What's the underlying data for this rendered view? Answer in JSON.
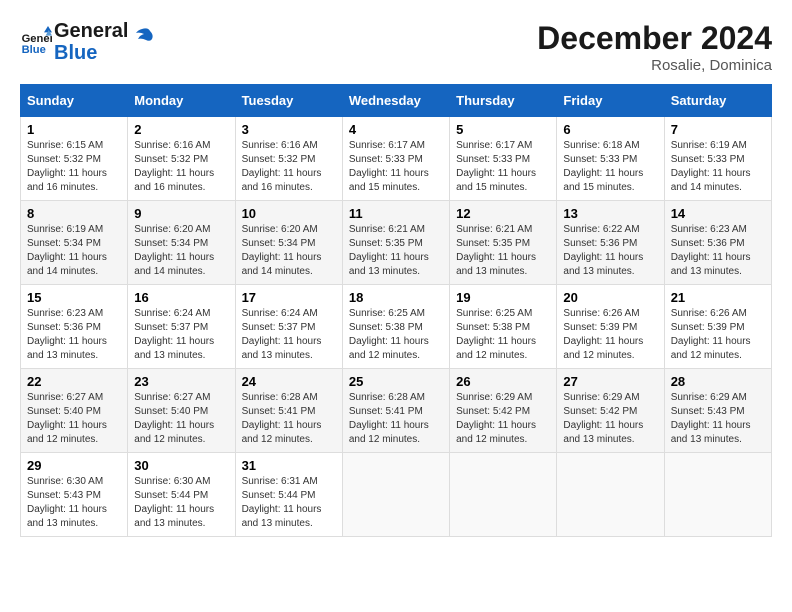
{
  "logo": {
    "text_general": "General",
    "text_blue": "Blue"
  },
  "title": "December 2024",
  "subtitle": "Rosalie, Dominica",
  "days_header": [
    "Sunday",
    "Monday",
    "Tuesday",
    "Wednesday",
    "Thursday",
    "Friday",
    "Saturday"
  ],
  "weeks": [
    [
      {
        "day": "1",
        "sunrise": "6:15 AM",
        "sunset": "5:32 PM",
        "daylight": "11 hours and 16 minutes."
      },
      {
        "day": "2",
        "sunrise": "6:16 AM",
        "sunset": "5:32 PM",
        "daylight": "11 hours and 16 minutes."
      },
      {
        "day": "3",
        "sunrise": "6:16 AM",
        "sunset": "5:32 PM",
        "daylight": "11 hours and 16 minutes."
      },
      {
        "day": "4",
        "sunrise": "6:17 AM",
        "sunset": "5:33 PM",
        "daylight": "11 hours and 15 minutes."
      },
      {
        "day": "5",
        "sunrise": "6:17 AM",
        "sunset": "5:33 PM",
        "daylight": "11 hours and 15 minutes."
      },
      {
        "day": "6",
        "sunrise": "6:18 AM",
        "sunset": "5:33 PM",
        "daylight": "11 hours and 15 minutes."
      },
      {
        "day": "7",
        "sunrise": "6:19 AM",
        "sunset": "5:33 PM",
        "daylight": "11 hours and 14 minutes."
      }
    ],
    [
      {
        "day": "8",
        "sunrise": "6:19 AM",
        "sunset": "5:34 PM",
        "daylight": "11 hours and 14 minutes."
      },
      {
        "day": "9",
        "sunrise": "6:20 AM",
        "sunset": "5:34 PM",
        "daylight": "11 hours and 14 minutes."
      },
      {
        "day": "10",
        "sunrise": "6:20 AM",
        "sunset": "5:34 PM",
        "daylight": "11 hours and 14 minutes."
      },
      {
        "day": "11",
        "sunrise": "6:21 AM",
        "sunset": "5:35 PM",
        "daylight": "11 hours and 13 minutes."
      },
      {
        "day": "12",
        "sunrise": "6:21 AM",
        "sunset": "5:35 PM",
        "daylight": "11 hours and 13 minutes."
      },
      {
        "day": "13",
        "sunrise": "6:22 AM",
        "sunset": "5:36 PM",
        "daylight": "11 hours and 13 minutes."
      },
      {
        "day": "14",
        "sunrise": "6:23 AM",
        "sunset": "5:36 PM",
        "daylight": "11 hours and 13 minutes."
      }
    ],
    [
      {
        "day": "15",
        "sunrise": "6:23 AM",
        "sunset": "5:36 PM",
        "daylight": "11 hours and 13 minutes."
      },
      {
        "day": "16",
        "sunrise": "6:24 AM",
        "sunset": "5:37 PM",
        "daylight": "11 hours and 13 minutes."
      },
      {
        "day": "17",
        "sunrise": "6:24 AM",
        "sunset": "5:37 PM",
        "daylight": "11 hours and 13 minutes."
      },
      {
        "day": "18",
        "sunrise": "6:25 AM",
        "sunset": "5:38 PM",
        "daylight": "11 hours and 12 minutes."
      },
      {
        "day": "19",
        "sunrise": "6:25 AM",
        "sunset": "5:38 PM",
        "daylight": "11 hours and 12 minutes."
      },
      {
        "day": "20",
        "sunrise": "6:26 AM",
        "sunset": "5:39 PM",
        "daylight": "11 hours and 12 minutes."
      },
      {
        "day": "21",
        "sunrise": "6:26 AM",
        "sunset": "5:39 PM",
        "daylight": "11 hours and 12 minutes."
      }
    ],
    [
      {
        "day": "22",
        "sunrise": "6:27 AM",
        "sunset": "5:40 PM",
        "daylight": "11 hours and 12 minutes."
      },
      {
        "day": "23",
        "sunrise": "6:27 AM",
        "sunset": "5:40 PM",
        "daylight": "11 hours and 12 minutes."
      },
      {
        "day": "24",
        "sunrise": "6:28 AM",
        "sunset": "5:41 PM",
        "daylight": "11 hours and 12 minutes."
      },
      {
        "day": "25",
        "sunrise": "6:28 AM",
        "sunset": "5:41 PM",
        "daylight": "11 hours and 12 minutes."
      },
      {
        "day": "26",
        "sunrise": "6:29 AM",
        "sunset": "5:42 PM",
        "daylight": "11 hours and 12 minutes."
      },
      {
        "day": "27",
        "sunrise": "6:29 AM",
        "sunset": "5:42 PM",
        "daylight": "11 hours and 13 minutes."
      },
      {
        "day": "28",
        "sunrise": "6:29 AM",
        "sunset": "5:43 PM",
        "daylight": "11 hours and 13 minutes."
      }
    ],
    [
      {
        "day": "29",
        "sunrise": "6:30 AM",
        "sunset": "5:43 PM",
        "daylight": "11 hours and 13 minutes."
      },
      {
        "day": "30",
        "sunrise": "6:30 AM",
        "sunset": "5:44 PM",
        "daylight": "11 hours and 13 minutes."
      },
      {
        "day": "31",
        "sunrise": "6:31 AM",
        "sunset": "5:44 PM",
        "daylight": "11 hours and 13 minutes."
      },
      null,
      null,
      null,
      null
    ]
  ],
  "labels": {
    "sunrise": "Sunrise: ",
    "sunset": "Sunset: ",
    "daylight": "Daylight: "
  }
}
